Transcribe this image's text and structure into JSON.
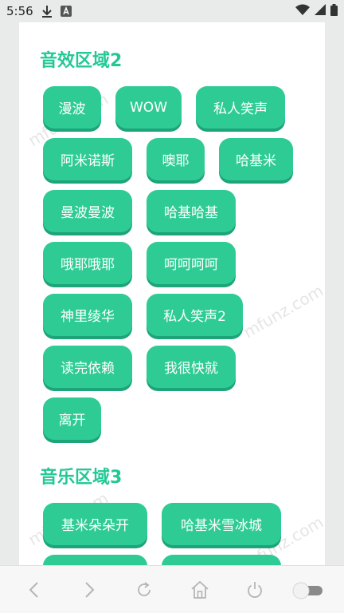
{
  "status_bar": {
    "time": "5:56",
    "icons": [
      "download-icon",
      "app-a-icon",
      "wifi-icon",
      "signal-icon",
      "battery-icon"
    ]
  },
  "watermark": "mfunz.com",
  "sections": [
    {
      "title": "音效区域2",
      "rows": [
        [
          "漫波",
          "WOW",
          "私人笑声"
        ],
        [
          "阿米诺斯",
          "噢耶",
          "哈基米"
        ],
        [
          "曼波曼波",
          "哈基哈基"
        ],
        [
          "哦耶哦耶",
          "呵呵呵呵"
        ],
        [
          "神里绫华",
          "私人笑声2"
        ],
        [
          "读完依赖",
          "我很快就"
        ],
        [
          "离开"
        ]
      ]
    },
    {
      "title": "音乐区域3",
      "rows": [
        [
          "基米朵朵开",
          "哈基米雪冰城"
        ],
        [
          "",
          ""
        ]
      ]
    }
  ],
  "bottom_nav": {
    "items": [
      "back-icon",
      "forward-icon",
      "refresh-icon",
      "home-icon",
      "power-icon",
      "toggle-switch"
    ]
  },
  "colors": {
    "accent": "#2ecc94",
    "title": "#22c895"
  }
}
